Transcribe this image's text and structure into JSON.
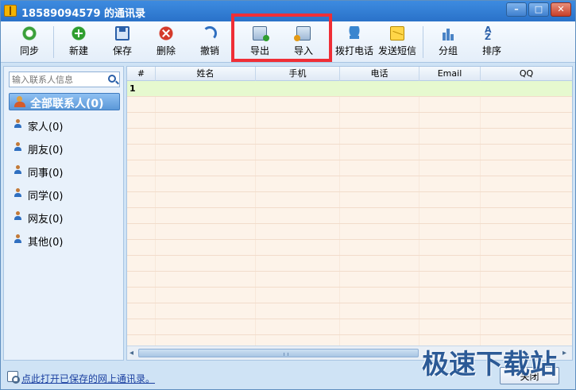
{
  "window": {
    "title": "18589094579 的通讯录",
    "controls": {
      "minimize": "–",
      "maximize": "□",
      "close": "✕"
    }
  },
  "toolbar": {
    "buttons": [
      {
        "label": "同步",
        "icon": "sync-icon"
      },
      {
        "label": "新建",
        "icon": "add-icon"
      },
      {
        "label": "保存",
        "icon": "save-icon"
      },
      {
        "label": "删除",
        "icon": "delete-icon"
      },
      {
        "label": "撤销",
        "icon": "undo-icon"
      },
      {
        "label": "导出",
        "icon": "export-icon"
      },
      {
        "label": "导入",
        "icon": "import-icon"
      },
      {
        "label": "拨打电话",
        "icon": "phone-icon"
      },
      {
        "label": "发送短信",
        "icon": "sms-icon"
      },
      {
        "label": "分组",
        "icon": "group-icon"
      },
      {
        "label": "排序",
        "icon": "sort-icon"
      }
    ],
    "highlight_color": "#ef2e36",
    "sort_glyph_top": "A",
    "sort_glyph_bottom": "Z"
  },
  "sidebar": {
    "search_placeholder": "输入联系人信息",
    "all_group": "全部联系人(0)",
    "groups": [
      {
        "label": "家人(0)"
      },
      {
        "label": "朋友(0)"
      },
      {
        "label": "同事(0)"
      },
      {
        "label": "同学(0)"
      },
      {
        "label": "网友(0)"
      },
      {
        "label": "其他(0)"
      }
    ]
  },
  "table": {
    "columns": [
      "#",
      "姓名",
      "手机",
      "电话",
      "Email",
      "QQ"
    ],
    "rows": [
      {
        "num": "1"
      }
    ],
    "scroll_left_arrow": "◂",
    "scroll_right_arrow": "▸"
  },
  "footer": {
    "link_text": "点此打开已保存的网上通讯录。",
    "close_button": "关闭"
  },
  "watermark": "极速下载站",
  "colors": {
    "titlebar": "#2a72c9",
    "window_bg": "#cfe3f5",
    "selected_row": "#e6f9cf",
    "grid_bg": "#fdf3e9"
  }
}
